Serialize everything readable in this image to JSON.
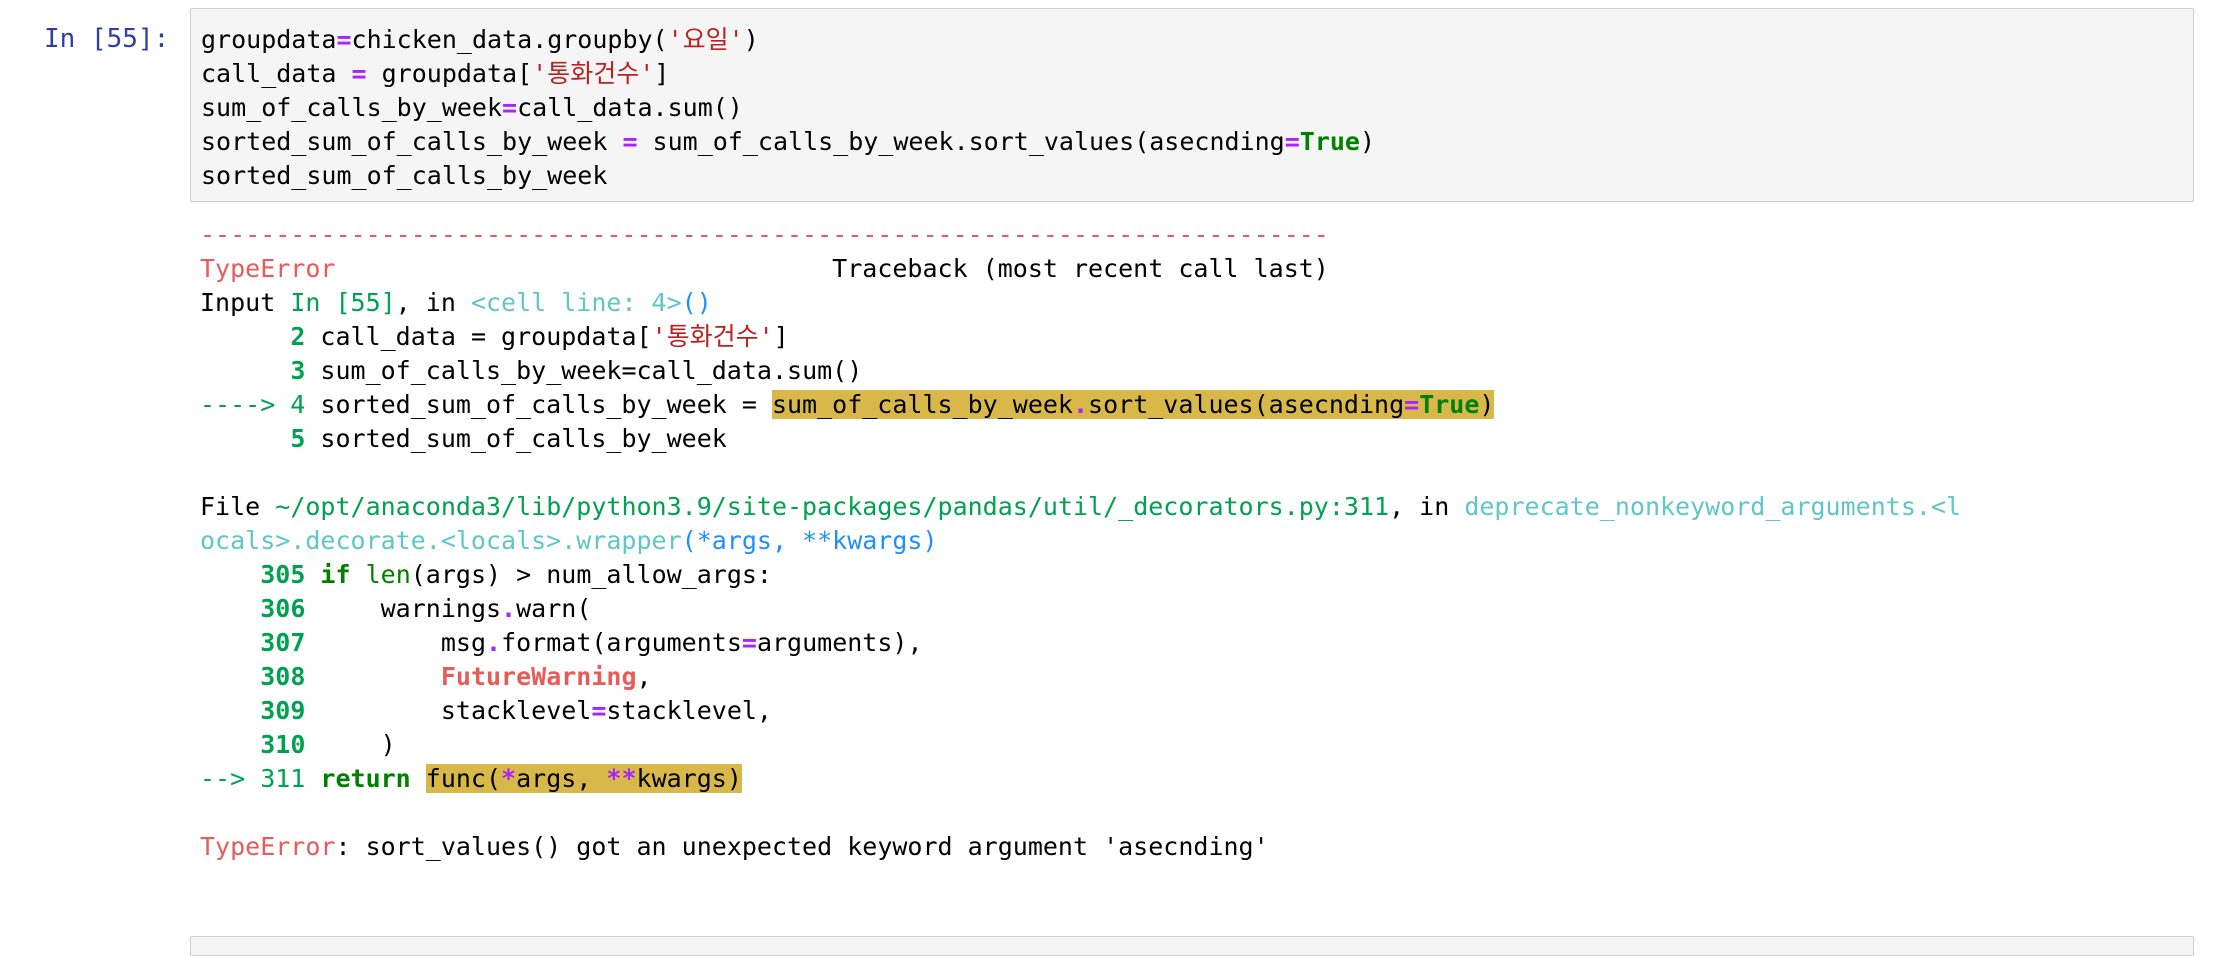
{
  "cell": {
    "prompt": "In [55]:",
    "code": {
      "l1a": "groupdata",
      "l1eq": "=",
      "l1b": "chicken_data.groupby(",
      "l1str": "'요일'",
      "l1c": ")",
      "l2a": "call_data ",
      "l2eq": "=",
      "l2b": " groupdata[",
      "l2str": "'통화건수'",
      "l2c": "]",
      "l3a": "sum_of_calls_by_week",
      "l3eq": "=",
      "l3b": "call_data.sum()",
      "l4a": "sorted_sum_of_calls_by_week ",
      "l4eq": "=",
      "l4b": " sum_of_calls_by_week.sort_values(asecnding",
      "l4eq2": "=",
      "l4kw": "True",
      "l4c": ")",
      "l5": "sorted_sum_of_calls_by_week"
    }
  },
  "output": {
    "dashes": "---------------------------------------------------------------------------",
    "error_name": "TypeError",
    "traceback_header": "                                 Traceback (most recent call last)",
    "input_prefix": "Input ",
    "input_cell": "In [55]",
    "input_in": ", in ",
    "cell_line": "<cell line: 4>",
    "cell_line_parens": "()",
    "f1": {
      "n2_pad": "      ",
      "n2": "2",
      "l2a": " call_data = groupdata[",
      "l2str": "'통화건수'",
      "l2b": "]",
      "n3_pad": "      ",
      "n3": "3",
      "l3": " sum_of_calls_by_week=call_data.sum()",
      "arrow4": "----> 4",
      "l4a": " sorted_sum_of_calls_by_week = ",
      "l4hl_a": "sum_of_calls_by_week",
      "l4hl_dot": ".",
      "l4hl_b": "sort_values(asecnding",
      "l4hl_eq": "=",
      "l4hl_kw": "True",
      "l4hl_c": ")",
      "n5_pad": "      ",
      "n5": "5",
      "l5": " sorted_sum_of_calls_by_week"
    },
    "file_prefix": "File ",
    "file_path": "~/opt/anaconda3/lib/python3.9/site-packages/pandas/util/_decorators.py:311",
    "file_in": ", in ",
    "func_name_1": "deprecate_nonkeyword_arguments.<l",
    "func_name_2": "ocals>.decorate.<locals>.wrapper",
    "func_args": "(*args, **kwargs)",
    "f2": {
      "pad": "    ",
      "n305": "305",
      "l305kw": " if",
      "l305a": " ",
      "l305b": "len",
      "l305c": "(args) > num_allow_args:",
      "n306": "306",
      "l306a": "     warnings",
      "l306dot": ".",
      "l306b": "warn(",
      "n307": "307",
      "l307a": "         msg",
      "l307dot": ".",
      "l307b": "format(arguments",
      "l307eq": "=",
      "l307c": "arguments),",
      "n308": "308",
      "l308pad": "         ",
      "l308warn": "FutureWarning",
      "l308c": ",",
      "n309": "309",
      "l309a": "         stacklevel",
      "l309eq": "=",
      "l309b": "stacklevel,",
      "n310": "310",
      "l310": "     )",
      "arrow311": "--> 311",
      "l311kw": " return",
      "l311sp": " ",
      "l311hl_a": "func(",
      "l311hl_star": "*",
      "l311hl_b": "args, ",
      "l311hl_stars": "**",
      "l311hl_c": "kwargs)"
    },
    "final_error_name": "TypeError",
    "final_error_msg": ": sort_values() got an unexpected keyword argument 'asecnding'"
  },
  "colors": {
    "prompt": "#303f9f",
    "error_red": "#e75c58",
    "green": "#00a250",
    "cyan": "#60c6c8",
    "blue": "#208ffb",
    "highlight": "#d9b84a",
    "string": "#ba2121",
    "keyword": "#008000",
    "operator": "#aa22ff"
  }
}
